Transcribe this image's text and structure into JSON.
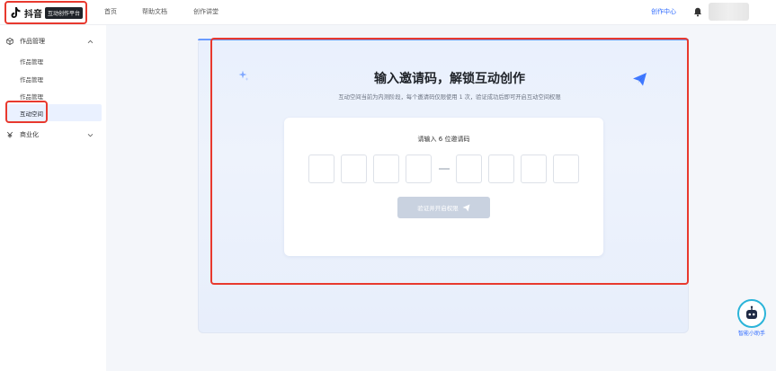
{
  "topbar": {
    "logo_text": "抖音",
    "logo_badge": "互动创作平台",
    "nav": [
      "首页",
      "帮助文档",
      "创作讲堂"
    ],
    "creator_center": "创作中心"
  },
  "sidebar": {
    "groups": [
      {
        "label": "作品管理",
        "items": [
          "作品管理",
          "作品管理",
          "作品管理",
          "互动空间"
        ]
      },
      {
        "label": "商业化"
      }
    ]
  },
  "main": {
    "headline": "输入邀请码，解锁互动创作",
    "subline": "互动空间当前为内测阶段，每个邀请码仅限使用 1 次，验证成功后即可开启互动空间权限",
    "code_title": "请输入 6 位邀请码",
    "submit_label": "验证并开启权限"
  },
  "helper": {
    "label": "智能小助手"
  },
  "colors": {
    "accent": "#2f6bff",
    "highlight": "#e8392e",
    "button_disabled": "#c9d2e0"
  }
}
